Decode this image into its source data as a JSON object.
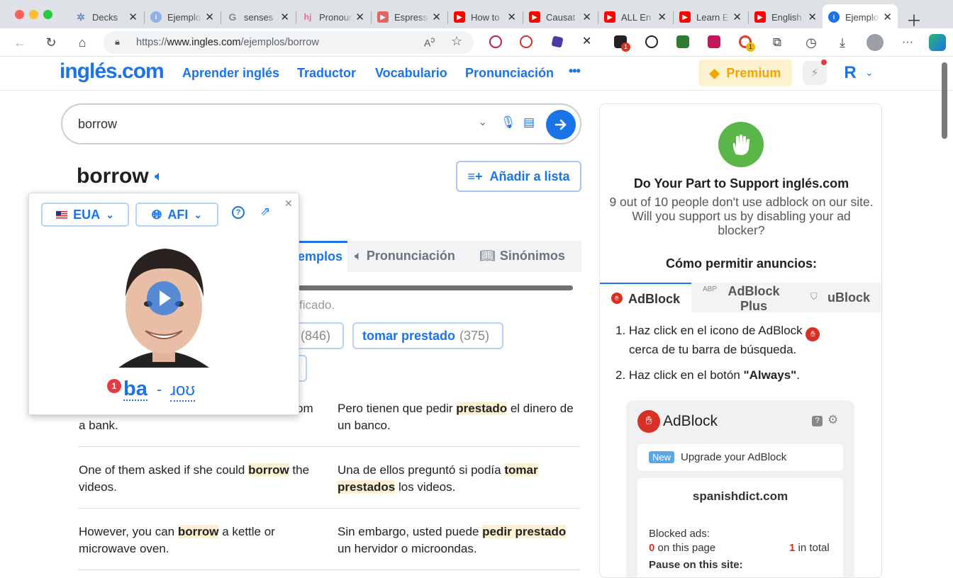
{
  "browser": {
    "tabs": [
      {
        "title": "Decks",
        "color": "#6c8ebf"
      },
      {
        "title": "Ejemplo",
        "color": "#5b8def"
      },
      {
        "title": "senses",
        "color": "#ffffff"
      },
      {
        "title": "Pronoun",
        "color": "#e86a8a"
      },
      {
        "title": "Espresso",
        "color": "#e06666"
      },
      {
        "title": "How to",
        "color": "#ff0000"
      },
      {
        "title": "Causat",
        "color": "#ff0000"
      },
      {
        "title": "ALL En",
        "color": "#ff0000"
      },
      {
        "title": "Learn E",
        "color": "#ff0000"
      },
      {
        "title": "English",
        "color": "#ff0000"
      },
      {
        "title": "Ejemplo",
        "color": "#1a73e8"
      }
    ],
    "url_prefix": "https://",
    "url_domain": "www.ingles.com",
    "url_path": "/ejemplos/borrow",
    "ext_badge_1": "1",
    "ext_badge_2": "1",
    "profile_initial": "R"
  },
  "site": {
    "logo": "inglés.com",
    "nav": [
      "Aprender inglés",
      "Traductor",
      "Vocabulario",
      "Pronunciación"
    ],
    "more": "•••",
    "premium": "Premium",
    "user_initial": "R"
  },
  "search": {
    "value": "borrow"
  },
  "word": {
    "headword": "borrow",
    "add_to_list": "Añadir a lista"
  },
  "section_tabs": {
    "ejemplos_partial": "emplos",
    "pronunciacion": "Pronunciación",
    "sinonimos": "Sinónimos"
  },
  "filter_text_partial": "ficado.",
  "chips": [
    {
      "label": "",
      "count": "(846)"
    },
    {
      "label": "tomar prestado",
      "count": "(375)"
    }
  ],
  "examples": [
    {
      "en_pre": "a bank.",
      "en_word": "",
      "en_post": "",
      "en_first_partial": "om",
      "es_pre": "Pero tienen que pedir ",
      "es_word": "prestado",
      "es_post": " el dinero de un banco."
    },
    {
      "en_pre": "One of them asked if she could ",
      "en_word": "borrow",
      "en_post": " the videos.",
      "es_pre": "Una de ellos preguntó si podía ",
      "es_word": "tomar prestados",
      "es_post": " los videos."
    },
    {
      "en_pre": "However, you can ",
      "en_word": "borrow",
      "en_post": " a kettle or microwave oven.",
      "es_pre": "Sin embargo, usted puede ",
      "es_word": "pedir prestado",
      "es_post": " un hervidor o microondas."
    }
  ],
  "popover": {
    "dialect": "EUA",
    "notation": "AFI",
    "badge": "1",
    "syllable_1": "ba",
    "dash": "-",
    "syllable_2": "ɹoʊ"
  },
  "sidebar": {
    "title": "Do Your Part to Support inglés.com",
    "message": "9 out of 10 people don't use adblock on our site. Will you support us by disabling your ad blocker?",
    "how_to": "Cómo permitir anuncios:",
    "tabs": [
      "AdBlock",
      "AdBlock Plus",
      "uBlock"
    ],
    "step1_pre": "Haz click en el icono de AdBlock",
    "step1_post": "cerca de tu barra de búsqueda.",
    "step2_pre": "Haz click en el botón ",
    "step2_bold": "\"Always\"",
    "step2_post": ".",
    "card": {
      "brand": "AdBlock",
      "new_badge": "New",
      "upgrade": "Upgrade your AdBlock",
      "site": "spanishdict.com",
      "blocked_label": "Blocked ads:",
      "on_page_count": "0",
      "on_page_label": "on this page",
      "total_count": "1",
      "total_label": "in total",
      "pause_partial": "Pause on this site:"
    }
  }
}
